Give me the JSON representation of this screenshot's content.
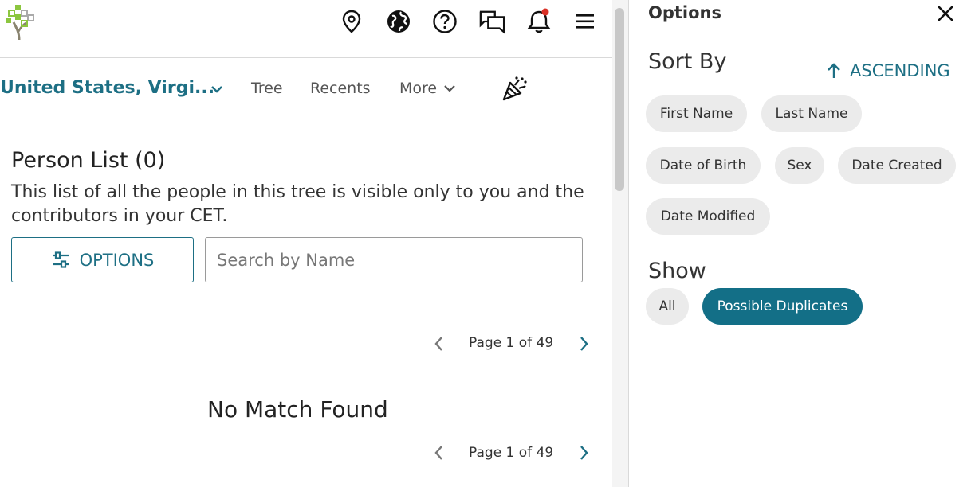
{
  "header": {
    "icons": [
      "logo-tree-icon",
      "map-pin-icon",
      "globe-icon",
      "help-icon",
      "chat-icon",
      "bell-icon",
      "menu-icon"
    ],
    "accent_color": "#1d6f84",
    "notification_dot_color": "#d93025"
  },
  "nav": {
    "location": "United States, Virgi...",
    "tree": "Tree",
    "recents": "Recents",
    "more": "More"
  },
  "main": {
    "title": "Person List (0)",
    "description": "This list of all the people in this tree is visible only to you and the contributors in your CET.",
    "options_button": "OPTIONS",
    "search_placeholder": "Search by Name",
    "pager_top": "Page 1 of 49",
    "no_match": "No Match Found",
    "pager_bottom": "Page 1 of 49"
  },
  "options_panel": {
    "title": "Options",
    "sort_by": "Sort By",
    "ascending": "ASCENDING",
    "sort_options": [
      "First Name",
      "Last Name",
      "Date of Birth",
      "Sex",
      "Date Created",
      "Date Modified"
    ],
    "show": "Show",
    "show_options": [
      "All",
      "Possible Duplicates"
    ],
    "selected_show": "Possible Duplicates",
    "selected_color": "#136f87"
  }
}
